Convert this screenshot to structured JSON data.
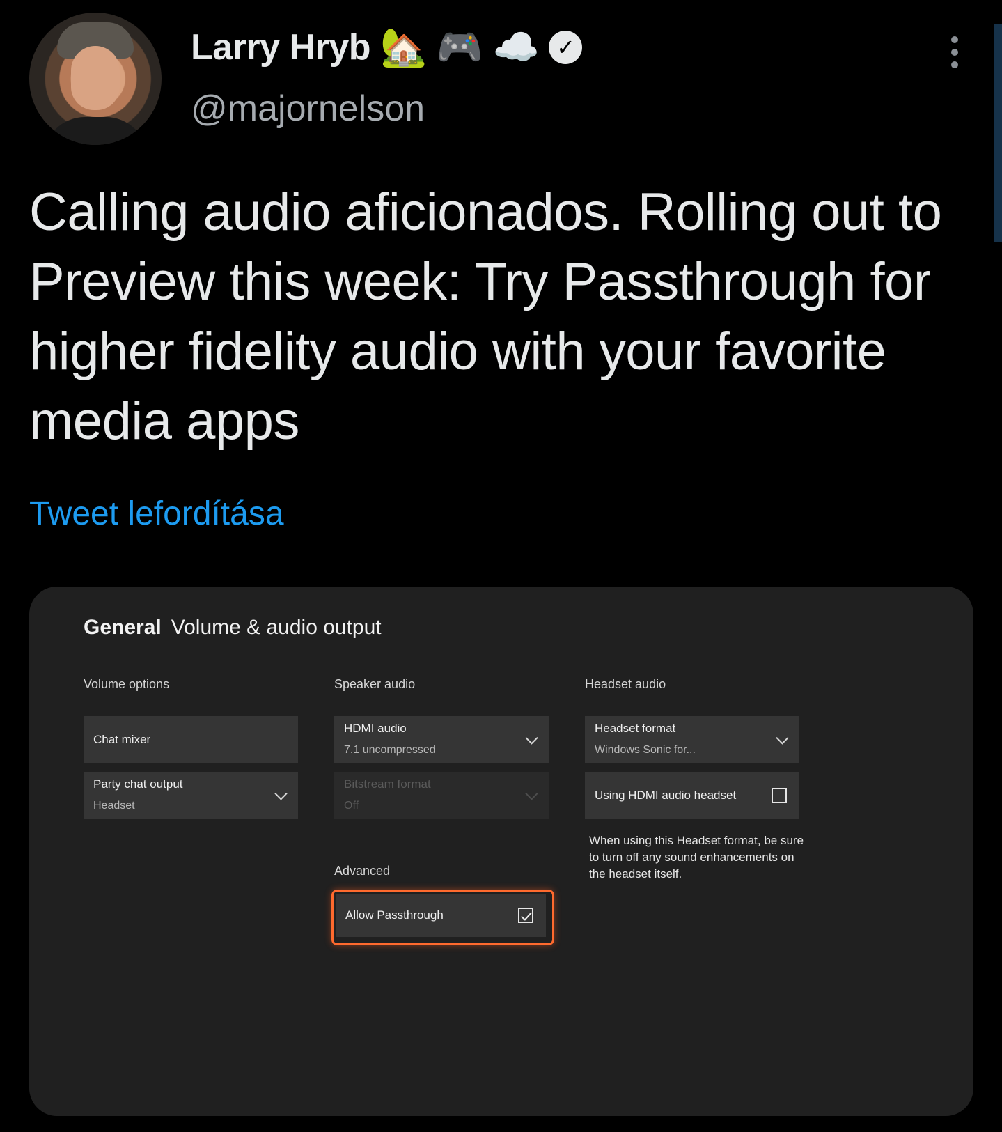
{
  "author": {
    "display_name": "Larry Hryb",
    "name_emojis": [
      "🏡",
      "🎮",
      "☁️"
    ],
    "verified_glyph": "✓",
    "handle": "@majornelson",
    "avatar_icon": "profile-photo"
  },
  "tweet": {
    "text": "Calling audio aficionados. Rolling out to Preview this week: Try Passthrough for higher fidelity audio with your favorite media apps",
    "translate_label": "Tweet lefordítása"
  },
  "media": {
    "breadcrumb_section": "General",
    "page_title": "Volume & audio output",
    "volume_options": {
      "label": "Volume options",
      "chat_mixer": "Chat mixer",
      "party_chat_output": "Party chat output",
      "party_chat_value": "Headset"
    },
    "speaker_audio": {
      "label": "Speaker audio",
      "hdmi_audio": "HDMI audio",
      "hdmi_value": "7.1 uncompressed",
      "bitstream_format": "Bitstream format",
      "bitstream_value": "Off",
      "advanced_label": "Advanced",
      "allow_passthrough": "Allow Passthrough",
      "allow_passthrough_checked": true
    },
    "headset_audio": {
      "label": "Headset audio",
      "headset_format": "Headset format",
      "headset_format_value": "Windows Sonic for...",
      "hdmi_headset": "Using HDMI audio headset",
      "hdmi_headset_checked": false,
      "note": "When using this Headset format, be sure to turn off any sound enhancements on the headset itself."
    }
  },
  "colors": {
    "background": "#000000",
    "link": "#1d9bf0",
    "focus_ring": "#ff6a2e",
    "card": "#202020"
  }
}
